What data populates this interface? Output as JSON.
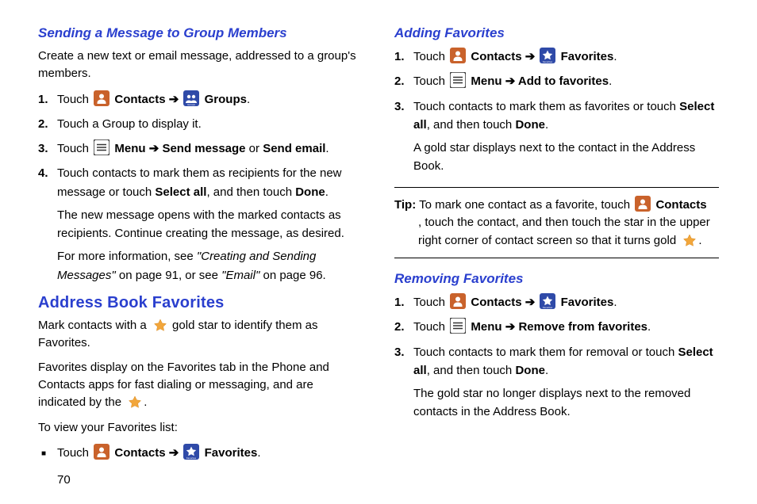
{
  "page_number": "70",
  "left": {
    "h1": "Sending a Message to Group Members",
    "intro": "Create a new text or email message, addressed to a group's members.",
    "step1_lead": "Touch ",
    "contacts": "Contacts",
    "arrow": " ➔ ",
    "groups": "Groups",
    "period": ".",
    "step2": "Touch a Group to display it.",
    "step3_lead": "Touch ",
    "menu": "Menu",
    "send_message": "Send message",
    "or": " or ",
    "send_email": "Send email",
    "step4_a": "Touch contacts to mark them as recipients for the new message or touch ",
    "select_all": "Select all",
    "step4_b": ", and then touch ",
    "done": "Done",
    "step4_sub1": "The new message opens with the marked contacts as recipients. Continue creating the message, as desired.",
    "step4_sub2a": "For more information, see ",
    "ref1": "\"Creating and Sending Messages\"",
    "step4_sub2b": " on page 91, or see ",
    "ref2": "\"Email\"",
    "step4_sub2c": " on page 96.",
    "h2": "Address Book Favorites",
    "p1a": "Mark contacts with a ",
    "p1b": " gold star to identify them as Favorites.",
    "p2a": "Favorites display on the Favorites tab in the Phone and Contacts apps for fast dialing or messaging, and are indicated by the ",
    "p2b": ".",
    "p3": "To view your Favorites list:",
    "bul_lead": "Touch ",
    "favorites": "Favorites"
  },
  "right": {
    "h1": "Adding Favorites",
    "touch": "Touch ",
    "contacts": "Contacts",
    "arrow": " ➔ ",
    "favorites": "Favorites",
    "period": ".",
    "menu": "Menu",
    "add_fav": "Add to favorites",
    "step3a": "Touch contacts to mark them as favorites or touch ",
    "select_all": "Select all",
    "andthen": ", and then touch ",
    "done": "Done",
    "step3_sub": "A gold star displays next to the contact in the Address Book.",
    "tip_label": "Tip:",
    "tip_a": " To mark one contact as a favorite, touch ",
    "tip_b": ", touch the contact, and then touch the star in the upper right corner of contact screen so that it turns gold ",
    "h2": "Removing Favorites",
    "rem_fav": "Remove from favorites",
    "rstep3a": "Touch contacts to mark them for removal or touch ",
    "rstep3_sub": "The gold star no longer displays next to the removed contacts in the Address Book."
  }
}
